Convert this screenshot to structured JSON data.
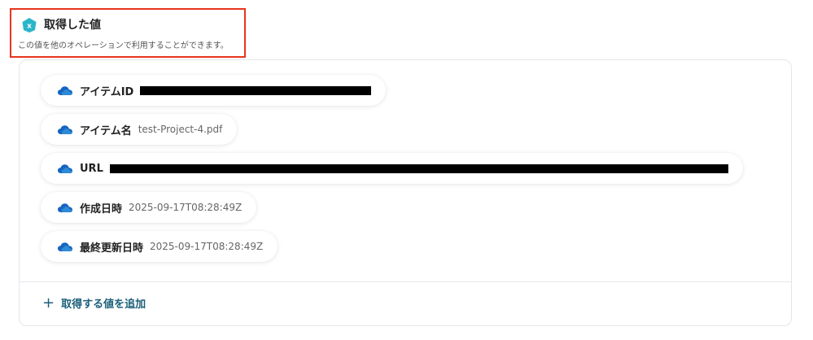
{
  "header": {
    "title": "取得した値",
    "description": "この値を他のオペレーションで利用することができます。",
    "accent_color": "#e8341c",
    "icon": "x-badge-icon"
  },
  "fields": [
    {
      "label": "アイテムID",
      "value": "",
      "redacted": true
    },
    {
      "label": "アイテム名",
      "value": "test-Project-4.pdf",
      "redacted": false
    },
    {
      "label": "URL",
      "value": "",
      "redacted": true
    },
    {
      "label": "作成日時",
      "value": "2025-09-17T08:28:49Z",
      "redacted": false
    },
    {
      "label": "最終更新日時",
      "value": "2025-09-17T08:28:49Z",
      "redacted": false
    }
  ],
  "field_icon": "onedrive-cloud-icon",
  "add_button": {
    "label": "取得する値を追加",
    "color": "#1b5f7a"
  }
}
